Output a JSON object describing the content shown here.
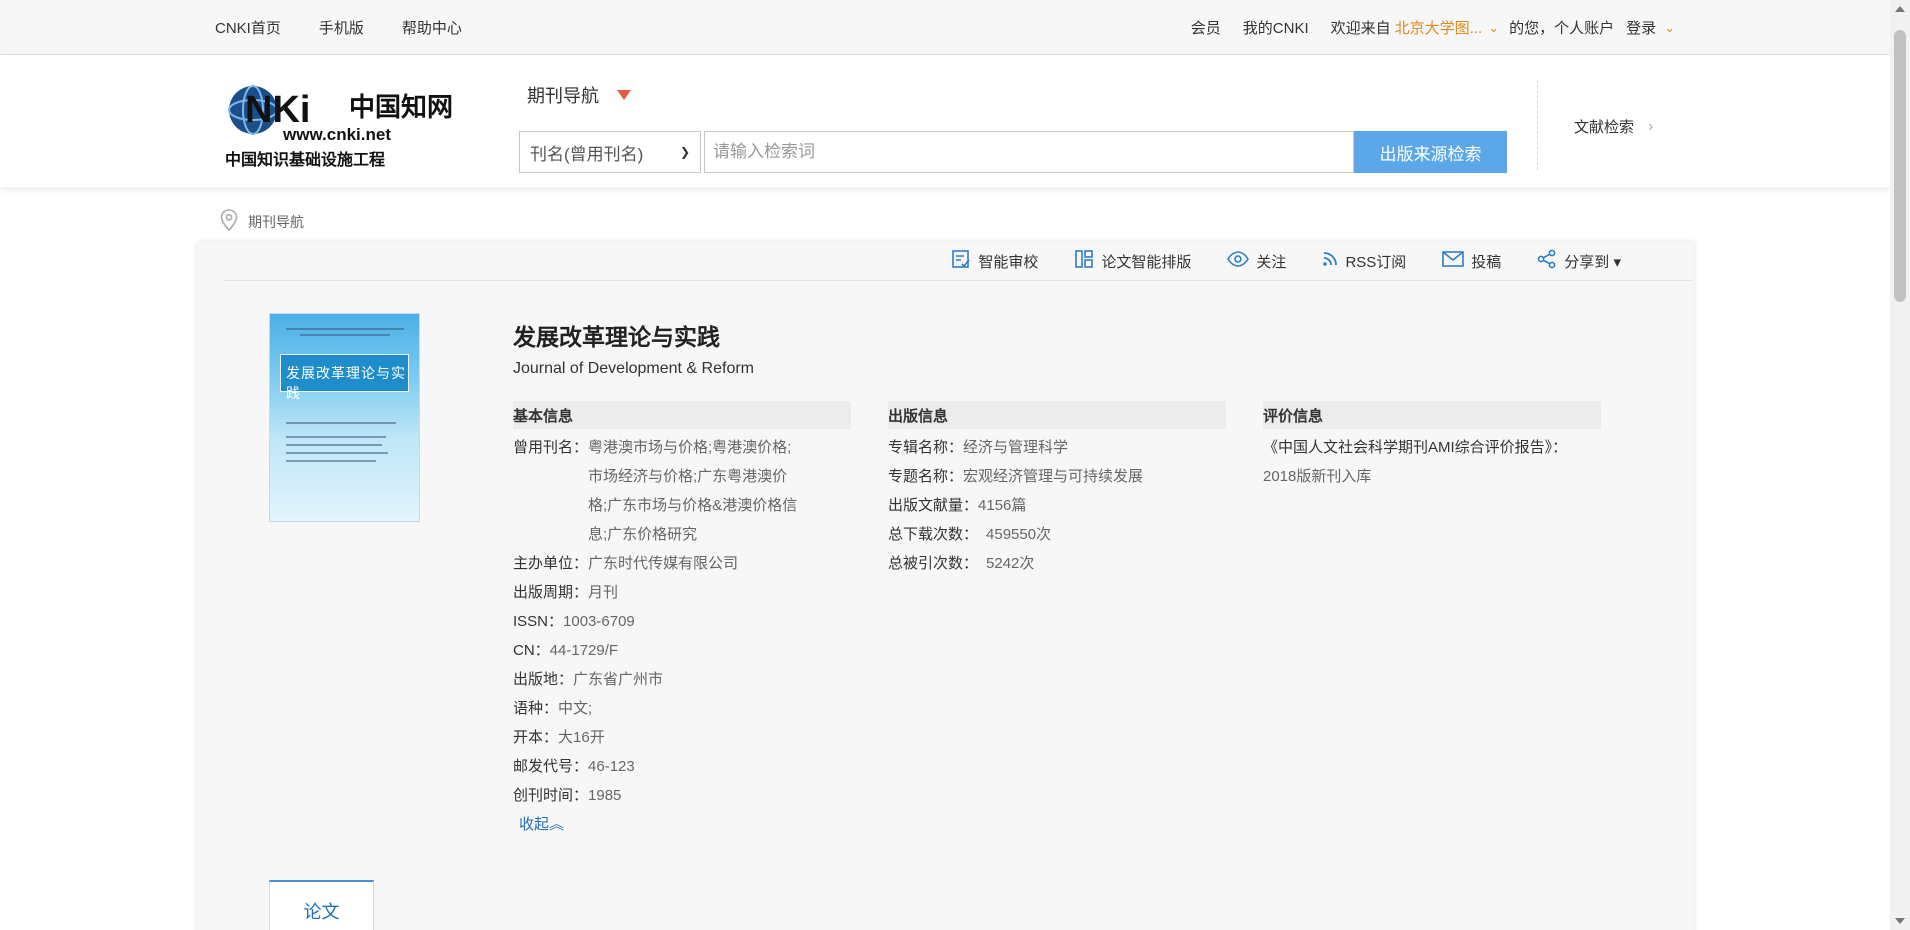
{
  "topbar": {
    "links": [
      "CNKI首页",
      "手机版",
      "帮助中心"
    ],
    "member": "会员",
    "my_cnki": "我的CNKI",
    "welcome": "欢迎来自",
    "org": "北京大学图...",
    "hello": "的您，个人账户",
    "login": "登录"
  },
  "header": {
    "nav_title": "期刊导航",
    "search_field": "刊名(曾用刊名)",
    "search_placeholder": "请输入检索词",
    "search_button": "出版来源检索",
    "lit_search": "文献检索"
  },
  "breadcrumb": "期刊导航",
  "toolbar": [
    "智能审校",
    "论文智能排版",
    "关注",
    "RSS订阅",
    "投稿",
    "分享到 ▾"
  ],
  "journal": {
    "title": "发展改革理论与实践",
    "title_en": "Journal of Development & Reform",
    "cover_title": "发展改革理论与实践"
  },
  "basic": {
    "heading": "基本信息",
    "former_names_label": "曾用刊名：",
    "former_names": "粤港澳市场与价格;粤港澳价格;市场经济与价格;广东粤港澳价格;广东市场与价格&港澳价格信息;广东价格研究",
    "sponsor_label": "主办单位：",
    "sponsor": "广东时代传媒有限公司",
    "cycle_label": "出版周期：",
    "cycle": "月刊",
    "issn_label": "ISSN：",
    "issn": "1003-6709",
    "cn_label": "CN：",
    "cn": "44-1729/F",
    "place_label": "出版地：",
    "place": "广东省广州市",
    "lang_label": "语种：",
    "lang": "中文;",
    "format_label": "开本：",
    "format": "大16开",
    "postal_label": "邮发代号：",
    "postal": "46-123",
    "founded_label": "创刊时间：",
    "founded": "1985",
    "collapse": "收起︽"
  },
  "publish": {
    "heading": "出版信息",
    "series_label": "专辑名称：",
    "series": "经济与管理科学",
    "topic_label": "专题名称：",
    "topic": "宏观经济管理与可持续发展",
    "count_label": "出版文献量：",
    "count": "4156篇",
    "downloads_label": "总下载次数：",
    "downloads": "459550次",
    "cited_label": "总被引次数：",
    "cited": "5242次"
  },
  "eval": {
    "heading": "评价信息",
    "line1": "《中国人文社会科学期刊AMI综合评价报告》：",
    "line2": "2018版新刊入库"
  },
  "tabs": {
    "paper": "论文"
  }
}
